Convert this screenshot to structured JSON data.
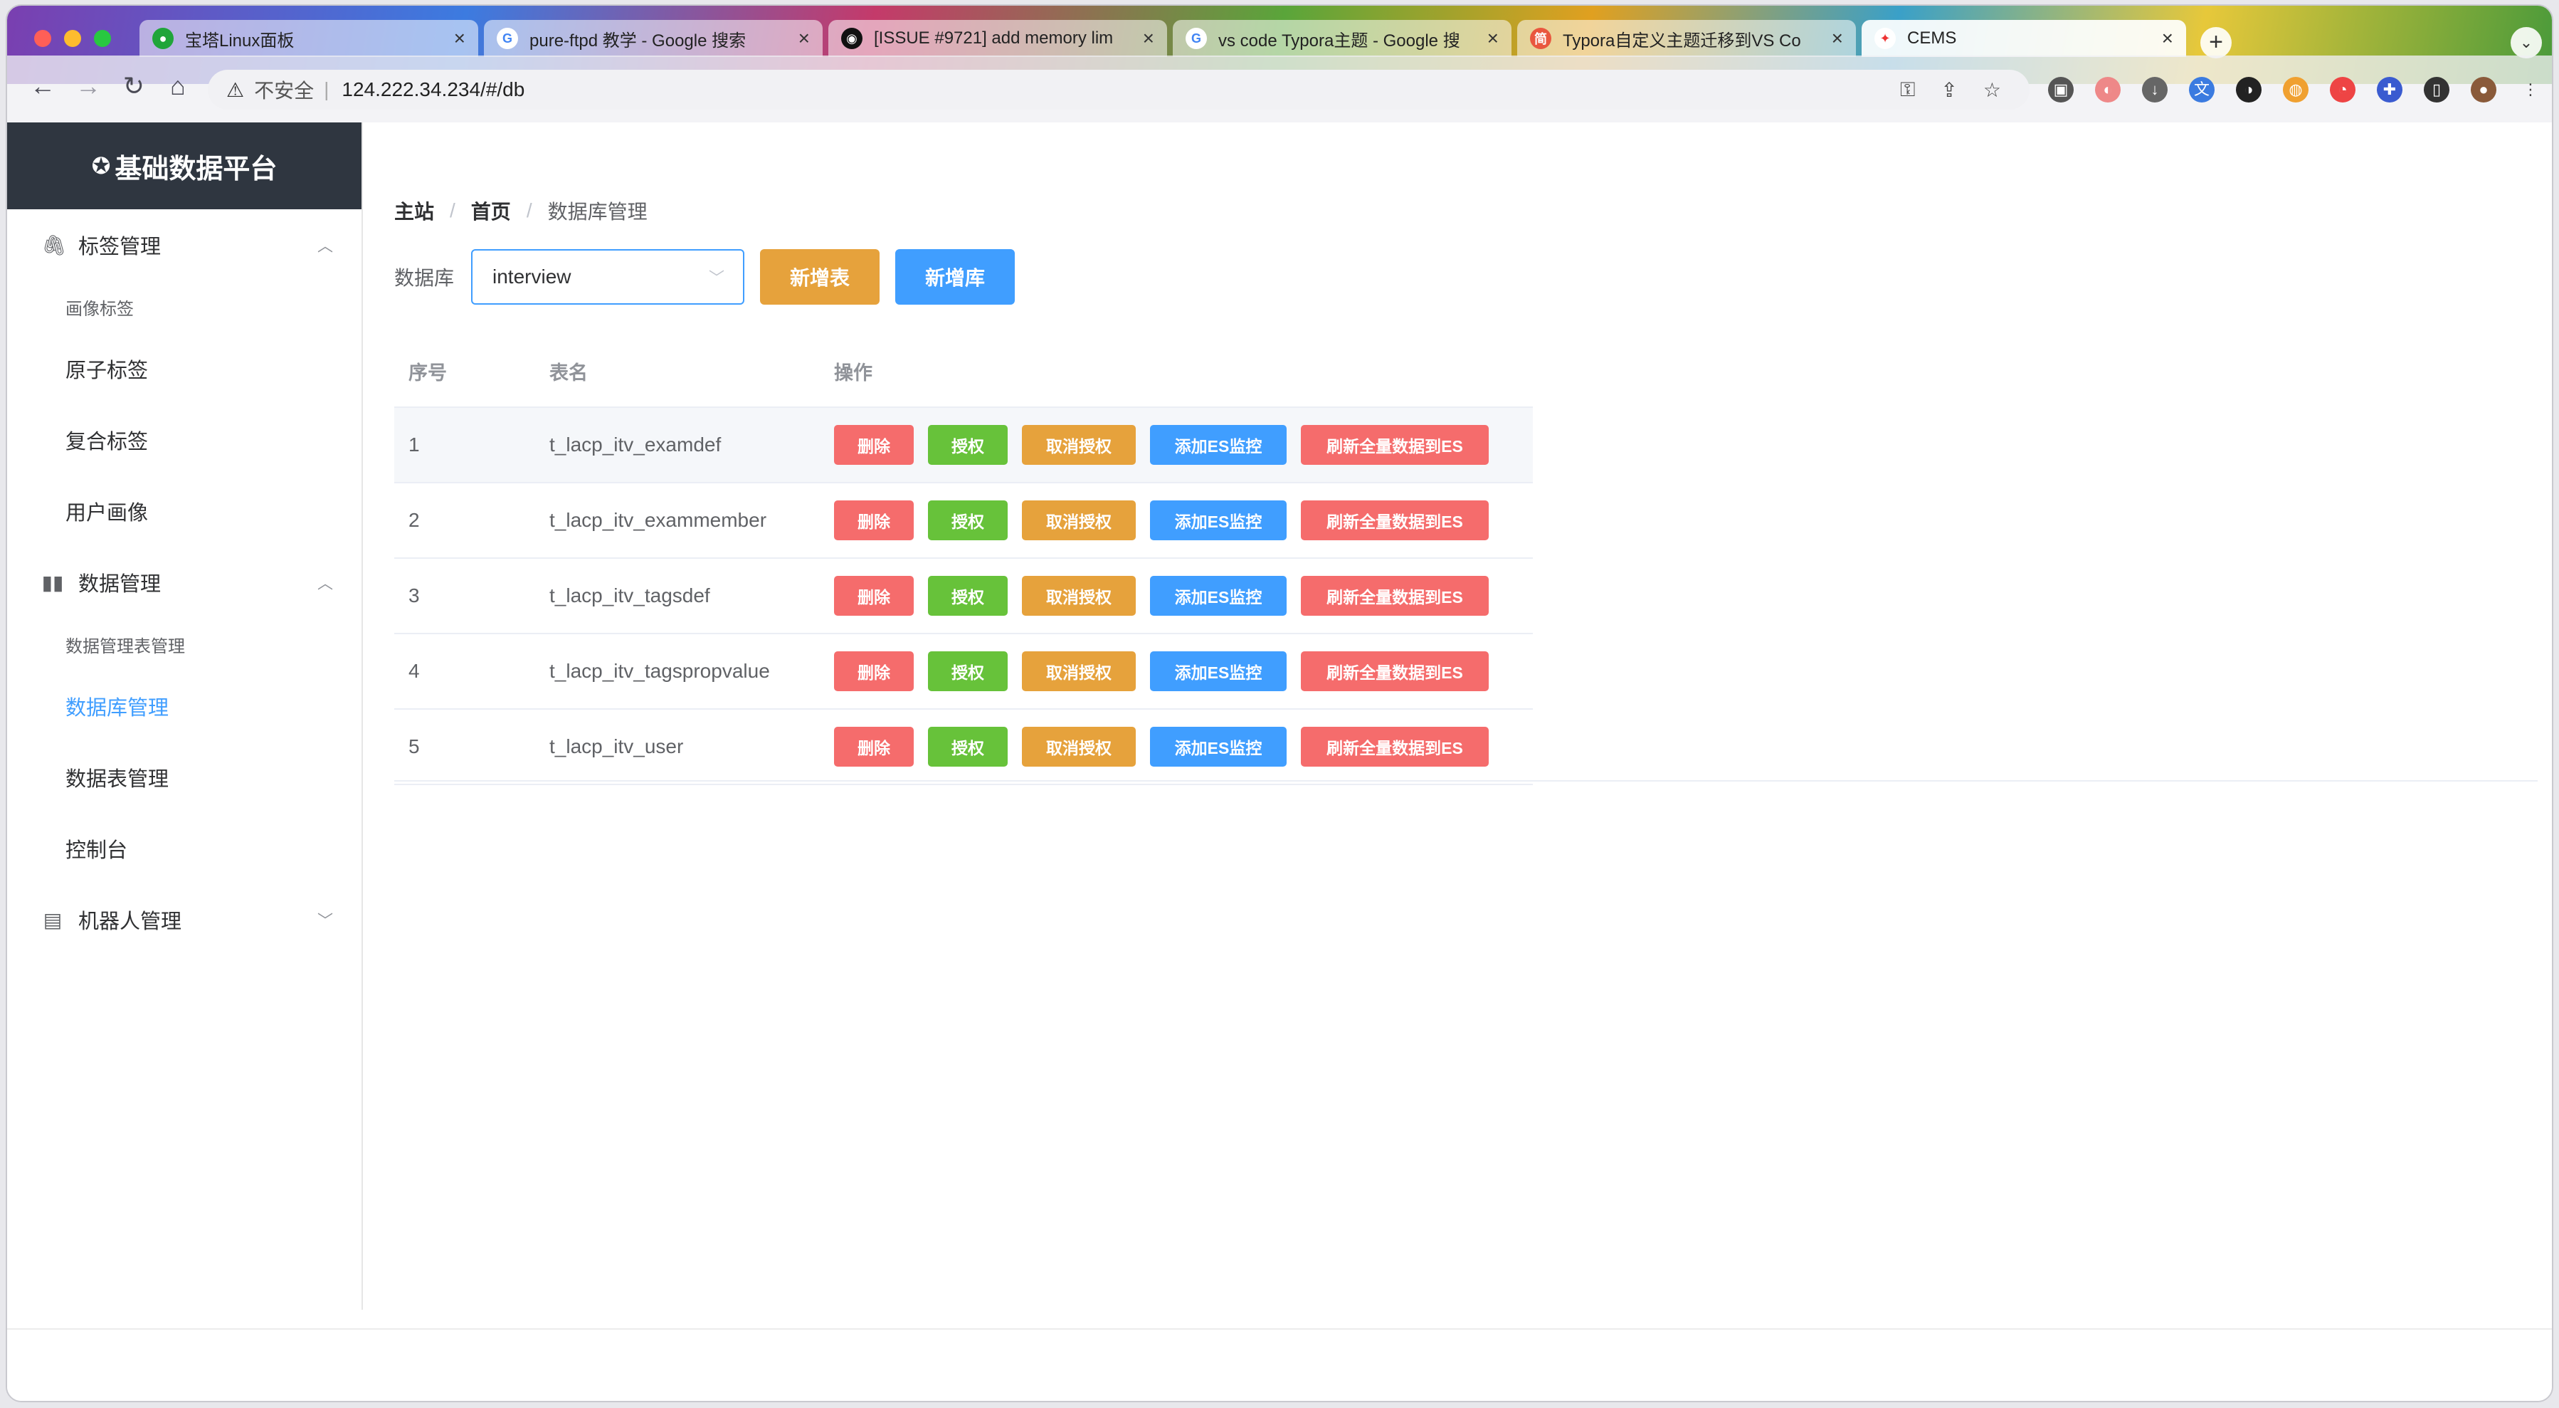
{
  "browser": {
    "tabs": [
      {
        "title": "宝塔Linux面板",
        "favicon": "green-leaf",
        "active": false
      },
      {
        "title": "pure-ftpd 教学 - Google 搜索",
        "favicon": "google-g",
        "active": false
      },
      {
        "title": "[ISSUE #9721] add memory lim",
        "favicon": "github-octocat",
        "active": false
      },
      {
        "title": "vs code Typora主题 - Google 搜",
        "favicon": "google-g",
        "active": false
      },
      {
        "title": "Typora自定义主题迁移到VS Co",
        "favicon": "jianshu-简",
        "active": false
      },
      {
        "title": "CEMS",
        "favicon": "cems-logo",
        "active": true
      }
    ],
    "new_tab_label": "+",
    "address": {
      "security_text": "不安全",
      "url": "124.222.34.234/#/db"
    }
  },
  "sidebar": {
    "brand": "基础数据平台",
    "groups": [
      {
        "label": "标签管理",
        "icon": "paperclip-icon",
        "expanded": true,
        "items": [
          {
            "label": "画像标签",
            "style": "small"
          },
          {
            "label": "原子标签"
          },
          {
            "label": "复合标签"
          },
          {
            "label": "用户画像"
          }
        ]
      },
      {
        "label": "数据管理",
        "icon": "bar-chart-icon",
        "expanded": true,
        "items": [
          {
            "label": "数据管理表管理",
            "style": "small"
          },
          {
            "label": "数据库管理",
            "active": true
          },
          {
            "label": "数据表管理"
          },
          {
            "label": "控制台"
          }
        ]
      },
      {
        "label": "机器人管理",
        "icon": "robot-icon",
        "expanded": false,
        "items": []
      }
    ]
  },
  "breadcrumb": [
    "主站",
    "首页",
    "数据库管理"
  ],
  "filter": {
    "label": "数据库",
    "selected": "interview",
    "add_table_button": "新增表",
    "add_db_button": "新增库"
  },
  "table": {
    "columns": [
      "序号",
      "表名",
      "操作"
    ],
    "actions": {
      "delete": "删除",
      "grant": "授权",
      "revoke": "取消授权",
      "add_es": "添加ES监控",
      "refresh_es": "刷新全量数据到ES"
    },
    "rows": [
      {
        "index": "1",
        "name": "t_lacp_itv_examdef"
      },
      {
        "index": "2",
        "name": "t_lacp_itv_exammember"
      },
      {
        "index": "3",
        "name": "t_lacp_itv_tagsdef"
      },
      {
        "index": "4",
        "name": "t_lacp_itv_tagspropvalue"
      },
      {
        "index": "5",
        "name": "t_lacp_itv_user"
      }
    ]
  },
  "colors": {
    "primary": "#409eff",
    "warning": "#e6a23c",
    "danger": "#f56c6c",
    "success": "#67c23a",
    "brand_bg": "#2f3640"
  }
}
